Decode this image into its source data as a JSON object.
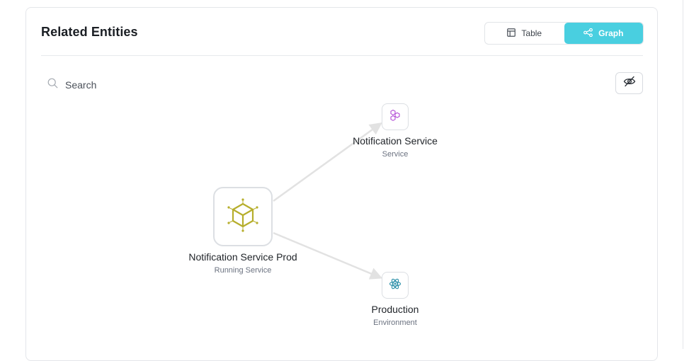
{
  "panel": {
    "title": "Related Entities",
    "view_toggle": {
      "table_label": "Table",
      "graph_label": "Graph",
      "active": "Graph"
    },
    "search": {
      "placeholder": "Search",
      "value": ""
    },
    "visibility_icon": "eye-off-icon"
  },
  "graph": {
    "nodes": [
      {
        "id": "root",
        "name": "Notification Service Prod",
        "type": "Running Service",
        "icon": "cube-icon",
        "color": "#b6ae2c"
      },
      {
        "id": "svc",
        "name": "Notification Service",
        "type": "Service",
        "icon": "service-icon",
        "color": "#b24bd6"
      },
      {
        "id": "env",
        "name": "Production",
        "type": "Environment",
        "icon": "atom-icon",
        "color": "#2b8fa8"
      }
    ],
    "edges": [
      {
        "from": "root",
        "to": "svc"
      },
      {
        "from": "root",
        "to": "env"
      }
    ]
  },
  "colors": {
    "accent": "#49cfe0",
    "edge": "#e2e2e2"
  }
}
